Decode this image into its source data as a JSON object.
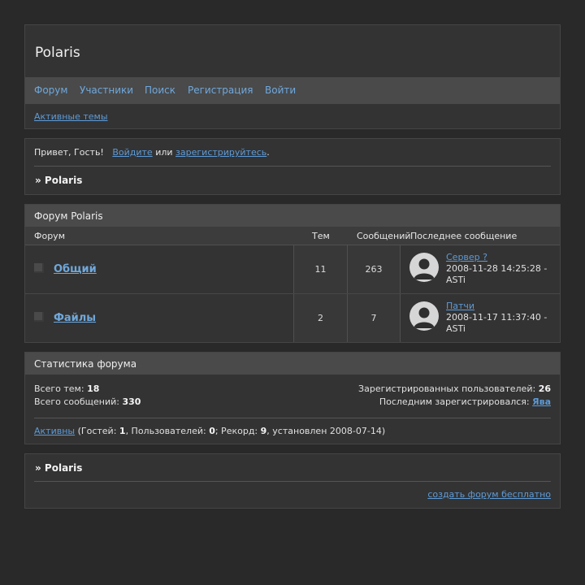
{
  "site": {
    "title": "Polaris"
  },
  "nav": {
    "items": [
      "Форум",
      "Участники",
      "Поиск",
      "Регистрация",
      "Войти"
    ],
    "active_topics": "Активные темы"
  },
  "welcome": {
    "greeting": "Привет, Гость!",
    "login": "Войдите",
    "or": "или",
    "register": "зарегистрируйтесь",
    "period": ".",
    "crumb": "» Polaris"
  },
  "forum_table": {
    "title": "Форум Polaris",
    "headers": {
      "forum": "Форум",
      "topics": "Тем",
      "posts": "Сообщений",
      "last": "Последнее сообщение"
    },
    "rows": [
      {
        "name": "Общий",
        "topics": "11",
        "posts": "263",
        "last_title": "Сервер ?",
        "last_date": "2008-11-28 14:25:28 -",
        "last_author": "ASTi"
      },
      {
        "name": "Файлы",
        "topics": "2",
        "posts": "7",
        "last_title": "Патчи",
        "last_date": "2008-11-17 11:37:40 -",
        "last_author": "ASTi"
      }
    ]
  },
  "stats": {
    "title": "Статистика форума",
    "total_topics_label": "Всего тем:",
    "total_topics": "18",
    "total_posts_label": "Всего сообщений:",
    "total_posts": "330",
    "registered_label": "Зарегистрированных пользователей:",
    "registered": "26",
    "last_registered_label": "Последним зарегистрировался:",
    "last_registered": "Ява",
    "active_link": "Активны",
    "guests_label": "(Гостей:",
    "guests": "1",
    "users_label": ", Пользователей:",
    "users": "0",
    "record_label": "; Рекорд:",
    "record": "9",
    "record_tail": ", установлен 2008-07-14)"
  },
  "footer": {
    "crumb": "» Polaris",
    "create_link": "создать форум бесплатно"
  },
  "colors": {
    "link": "#5d9bd8",
    "panel": "#333333",
    "bar": "#4a4a4a",
    "background": "#292929"
  }
}
